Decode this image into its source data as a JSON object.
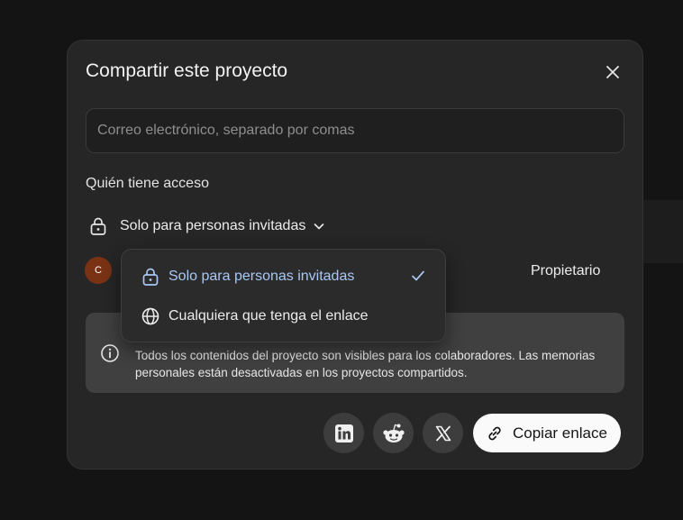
{
  "dialog": {
    "title": "Compartir este proyecto",
    "email_placeholder": "Correo electrónico, separado por comas",
    "access_label": "Quién tiene acceso",
    "access_selected": "Solo para personas invitadas",
    "member": {
      "initial": "C",
      "role": "Propietario",
      "avatar_color": "#7a3215"
    },
    "info_text": "Todos los contenidos del proyecto son visibles para los colaboradores. Las memorias personales están desactivadas en los proyectos compartidos.",
    "copy_label": "Copiar enlace",
    "share_icons": [
      "linkedin-icon",
      "reddit-icon",
      "x-icon"
    ]
  },
  "dropdown": {
    "options": [
      {
        "label": "Solo para personas invitadas",
        "icon": "lock-icon",
        "selected": true
      },
      {
        "label": "Cualquiera que tenga el enlace",
        "icon": "globe-icon",
        "selected": false
      }
    ],
    "selected_color": "#a9c8f5"
  },
  "colors": {
    "background": "#141414",
    "dialog": "#262626",
    "info_box": "#404040"
  }
}
